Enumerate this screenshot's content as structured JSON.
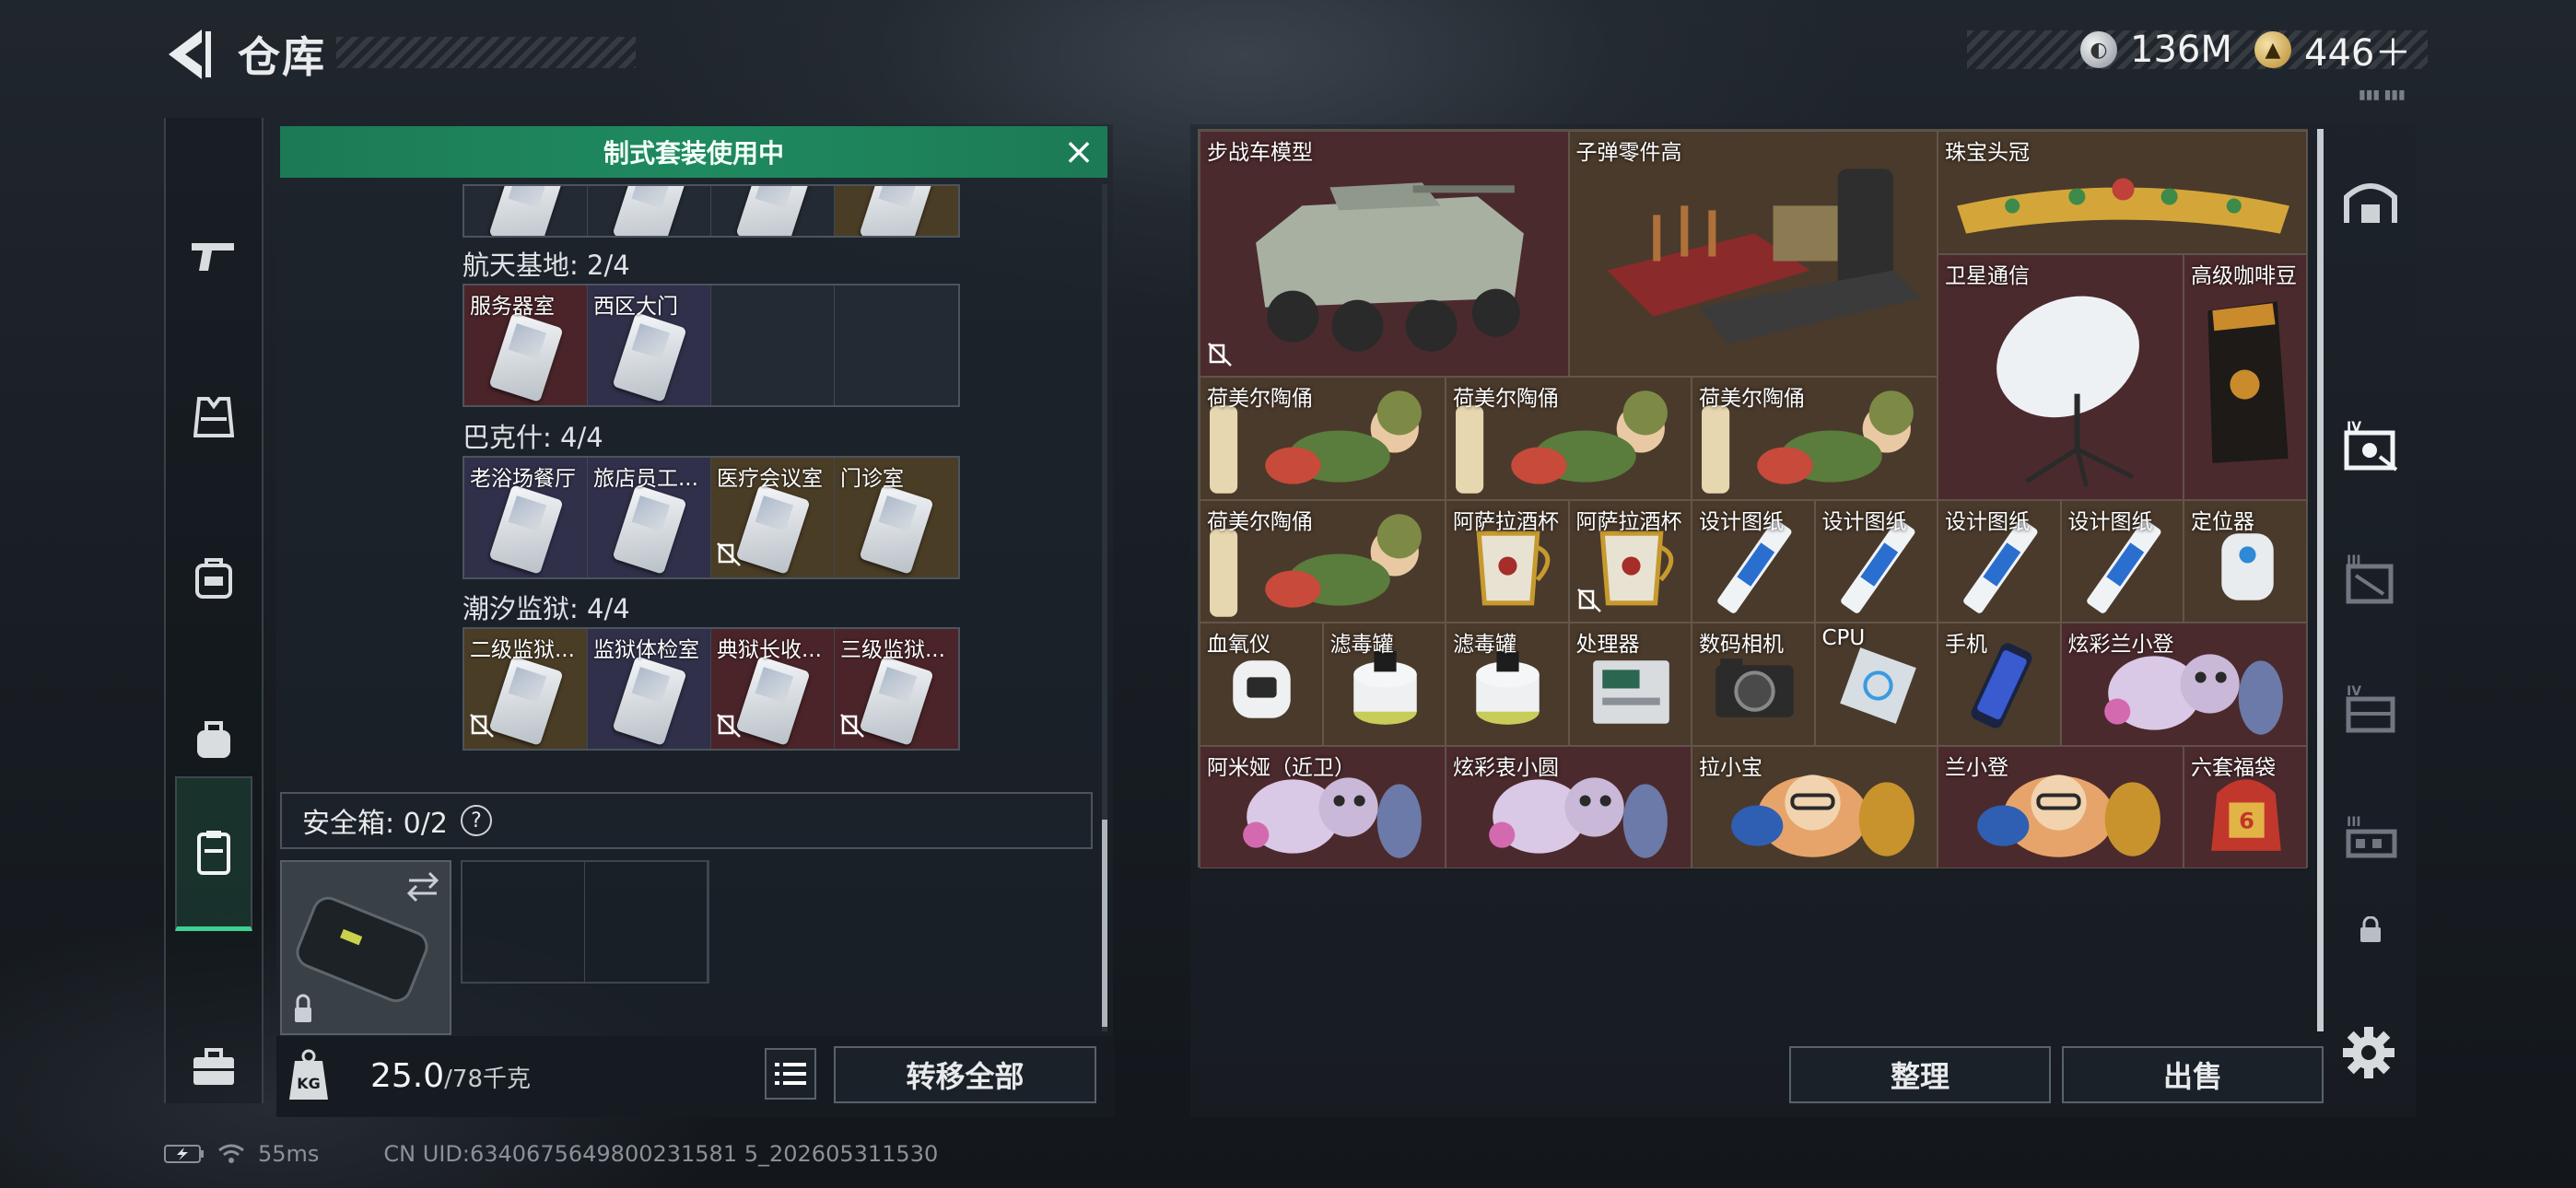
{
  "header": {
    "title": "仓库"
  },
  "currency": [
    {
      "name": "hafu-coin-icon",
      "value": "136M"
    },
    {
      "name": "triangle-coin-icon",
      "value": "446＋"
    }
  ],
  "top_right_small": "▮▮▮ ▮▮▮",
  "left_sidebar": [
    {
      "name": "weapons-tab",
      "active": false
    },
    {
      "name": "armor-tab",
      "active": false
    },
    {
      "name": "chest-rig-tab",
      "active": false
    },
    {
      "name": "backpack-tab",
      "active": false
    },
    {
      "name": "key-card-tab",
      "active": true
    },
    {
      "name": "toolbox-tab",
      "active": false
    }
  ],
  "banner": {
    "text": "制式套装使用中"
  },
  "key_groups": [
    {
      "title": "航天基地: 2/4",
      "slots": [
        {
          "label": "服务器室",
          "rarity": "red",
          "nobind": false
        },
        {
          "label": "西区大门",
          "rarity": "purple",
          "nobind": false
        },
        {
          "label": "",
          "rarity": "empty",
          "nobind": false
        },
        {
          "label": "",
          "rarity": "empty",
          "nobind": false
        }
      ]
    },
    {
      "title": "巴克什: 4/4",
      "slots": [
        {
          "label": "老浴场餐厅",
          "rarity": "purple",
          "nobind": false
        },
        {
          "label": "旅店员工...",
          "rarity": "purple",
          "nobind": false
        },
        {
          "label": "医疗会议室",
          "rarity": "gold",
          "nobind": true
        },
        {
          "label": "门诊室",
          "rarity": "gold",
          "nobind": false
        }
      ]
    },
    {
      "title": "潮汐监狱: 4/4",
      "slots": [
        {
          "label": "二级监狱...",
          "rarity": "gold",
          "nobind": true
        },
        {
          "label": "监狱体检室",
          "rarity": "purple",
          "nobind": false
        },
        {
          "label": "典狱长收...",
          "rarity": "red",
          "nobind": true
        },
        {
          "label": "三级监狱...",
          "rarity": "red",
          "nobind": true
        }
      ]
    }
  ],
  "safe_box": {
    "label": "安全箱: 0/2",
    "help": "?"
  },
  "left_bottom": {
    "weight_value": "25.0",
    "weight_max": "/78千克",
    "transfer_label": "转移全部"
  },
  "stash_items": [
    {
      "label": "步战车模型",
      "col": 0,
      "row": 0,
      "w": 3,
      "h": 2,
      "bg": "r",
      "art": "vehicle",
      "nobind": true
    },
    {
      "label": "子弹零件高",
      "col": 3,
      "row": 0,
      "w": 3,
      "h": 2,
      "bg": "g",
      "art": "crates",
      "nobind": false
    },
    {
      "label": "珠宝头冠",
      "col": 6,
      "row": 0,
      "w": 3,
      "h": 1,
      "bg": "g",
      "art": "crown",
      "nobind": false
    },
    {
      "label": "卫星通信",
      "col": 6,
      "row": 1,
      "w": 2,
      "h": 2,
      "bg": "r",
      "art": "dish",
      "nobind": false
    },
    {
      "label": "高级咖啡豆",
      "col": 8,
      "row": 1,
      "w": 1,
      "h": 2,
      "bg": "r",
      "art": "coffee",
      "nobind": false
    },
    {
      "label": "荷美尔陶俑",
      "col": 0,
      "row": 2,
      "w": 2,
      "h": 1,
      "bg": "g",
      "art": "figurine",
      "nobind": false
    },
    {
      "label": "荷美尔陶俑",
      "col": 2,
      "row": 2,
      "w": 2,
      "h": 1,
      "bg": "g",
      "art": "figurine",
      "nobind": false
    },
    {
      "label": "荷美尔陶俑",
      "col": 4,
      "row": 2,
      "w": 2,
      "h": 1,
      "bg": "g",
      "art": "figurine",
      "nobind": false
    },
    {
      "label": "荷美尔陶俑",
      "col": 0,
      "row": 3,
      "w": 2,
      "h": 1,
      "bg": "g",
      "art": "figurine",
      "nobind": false
    },
    {
      "label": "阿萨拉酒杯",
      "col": 2,
      "row": 3,
      "w": 1,
      "h": 1,
      "bg": "g",
      "art": "cup",
      "nobind": false
    },
    {
      "label": "阿萨拉酒杯",
      "col": 3,
      "row": 3,
      "w": 1,
      "h": 1,
      "bg": "g",
      "art": "cup",
      "nobind": true
    },
    {
      "label": "设计图纸",
      "col": 4,
      "row": 3,
      "w": 1,
      "h": 1,
      "bg": "g",
      "art": "blueprint",
      "nobind": false
    },
    {
      "label": "设计图纸",
      "col": 5,
      "row": 3,
      "w": 1,
      "h": 1,
      "bg": "g",
      "art": "blueprint",
      "nobind": false
    },
    {
      "label": "设计图纸",
      "col": 6,
      "row": 3,
      "w": 1,
      "h": 1,
      "bg": "g",
      "art": "blueprint",
      "nobind": false
    },
    {
      "label": "设计图纸",
      "col": 7,
      "row": 3,
      "w": 1,
      "h": 1,
      "bg": "g",
      "art": "blueprint",
      "nobind": false
    },
    {
      "label": "定位器",
      "col": 8,
      "row": 3,
      "w": 1,
      "h": 1,
      "bg": "g",
      "art": "locator",
      "nobind": false
    },
    {
      "label": "血氧仪",
      "col": 0,
      "row": 4,
      "w": 1,
      "h": 1,
      "bg": "g",
      "art": "oximeter",
      "nobind": false
    },
    {
      "label": "滤毒罐",
      "col": 1,
      "row": 4,
      "w": 1,
      "h": 1,
      "bg": "g",
      "art": "filter",
      "nobind": false
    },
    {
      "label": "滤毒罐",
      "col": 2,
      "row": 4,
      "w": 1,
      "h": 1,
      "bg": "g",
      "art": "filter",
      "nobind": false
    },
    {
      "label": "处理器",
      "col": 3,
      "row": 4,
      "w": 1,
      "h": 1,
      "bg": "g",
      "art": "processor",
      "nobind": false
    },
    {
      "label": "数码相机",
      "col": 4,
      "row": 4,
      "w": 1,
      "h": 1,
      "bg": "g",
      "art": "camera",
      "nobind": false
    },
    {
      "label": "CPU",
      "col": 5,
      "row": 4,
      "w": 1,
      "h": 1,
      "bg": "g",
      "art": "cpu",
      "nobind": false
    },
    {
      "label": "手机",
      "col": 6,
      "row": 4,
      "w": 1,
      "h": 1,
      "bg": "g",
      "art": "phone",
      "nobind": false
    },
    {
      "label": "炫彩兰小登",
      "col": 7,
      "row": 4,
      "w": 2,
      "h": 1,
      "bg": "r",
      "art": "toy",
      "nobind": false
    },
    {
      "label": "阿米娅（近卫）",
      "col": 0,
      "row": 5,
      "w": 2,
      "h": 1,
      "bg": "r",
      "art": "toy",
      "nobind": false
    },
    {
      "label": "炫彩衷小圆",
      "col": 2,
      "row": 5,
      "w": 2,
      "h": 1,
      "bg": "r",
      "art": "toy",
      "nobind": false
    },
    {
      "label": "拉小宝",
      "col": 4,
      "row": 5,
      "w": 2,
      "h": 1,
      "bg": "g",
      "art": "toy2",
      "nobind": false
    },
    {
      "label": "兰小登",
      "col": 6,
      "row": 5,
      "w": 2,
      "h": 1,
      "bg": "r",
      "art": "toy2",
      "nobind": false
    },
    {
      "label": "六套福袋",
      "col": 8,
      "row": 5,
      "w": 1,
      "h": 1,
      "bg": "r",
      "art": "bag",
      "nobind": false
    }
  ],
  "right_bottom": {
    "sort_label": "整理",
    "sell_label": "出售"
  },
  "right_sidebar": [
    {
      "name": "stash-home-tab",
      "label": ""
    },
    {
      "name": "stash-page-4-tab",
      "label": "IV"
    },
    {
      "name": "stash-page-3-tab",
      "label": "III"
    },
    {
      "name": "stash-page-4b-tab",
      "label": "IV"
    },
    {
      "name": "stash-page-3b-tab",
      "label": "III"
    },
    {
      "name": "stash-locked-tab",
      "label": ""
    }
  ],
  "status": {
    "ping": "55ms",
    "uid": "CN UID:6340675649800231581 5_202605311530"
  },
  "colors": {
    "accent_green": "#3fd18f",
    "banner_green": "#1f8a5f",
    "red_item": "#4b2a2d",
    "gold_item": "#4a3a2b"
  }
}
